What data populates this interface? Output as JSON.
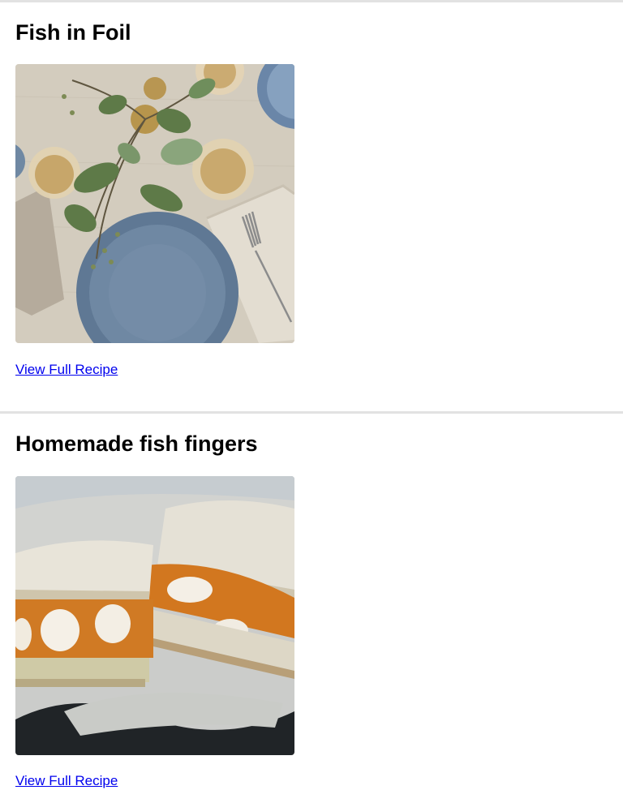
{
  "recipes": [
    {
      "title": "Fish in Foil",
      "image_alt": "Table setting with blue plates, glasses of wine, napkins, fork and eucalyptus sprigs",
      "link_label": "View Full Recipe"
    },
    {
      "title": "Homemade fish fingers",
      "image_alt": "Fish finger sandwiches on white bread over parchment paper",
      "link_label": "View Full Recipe"
    }
  ],
  "colors": {
    "link": "#0000ee",
    "divider": "#e2e2e2",
    "title": "#000000"
  }
}
